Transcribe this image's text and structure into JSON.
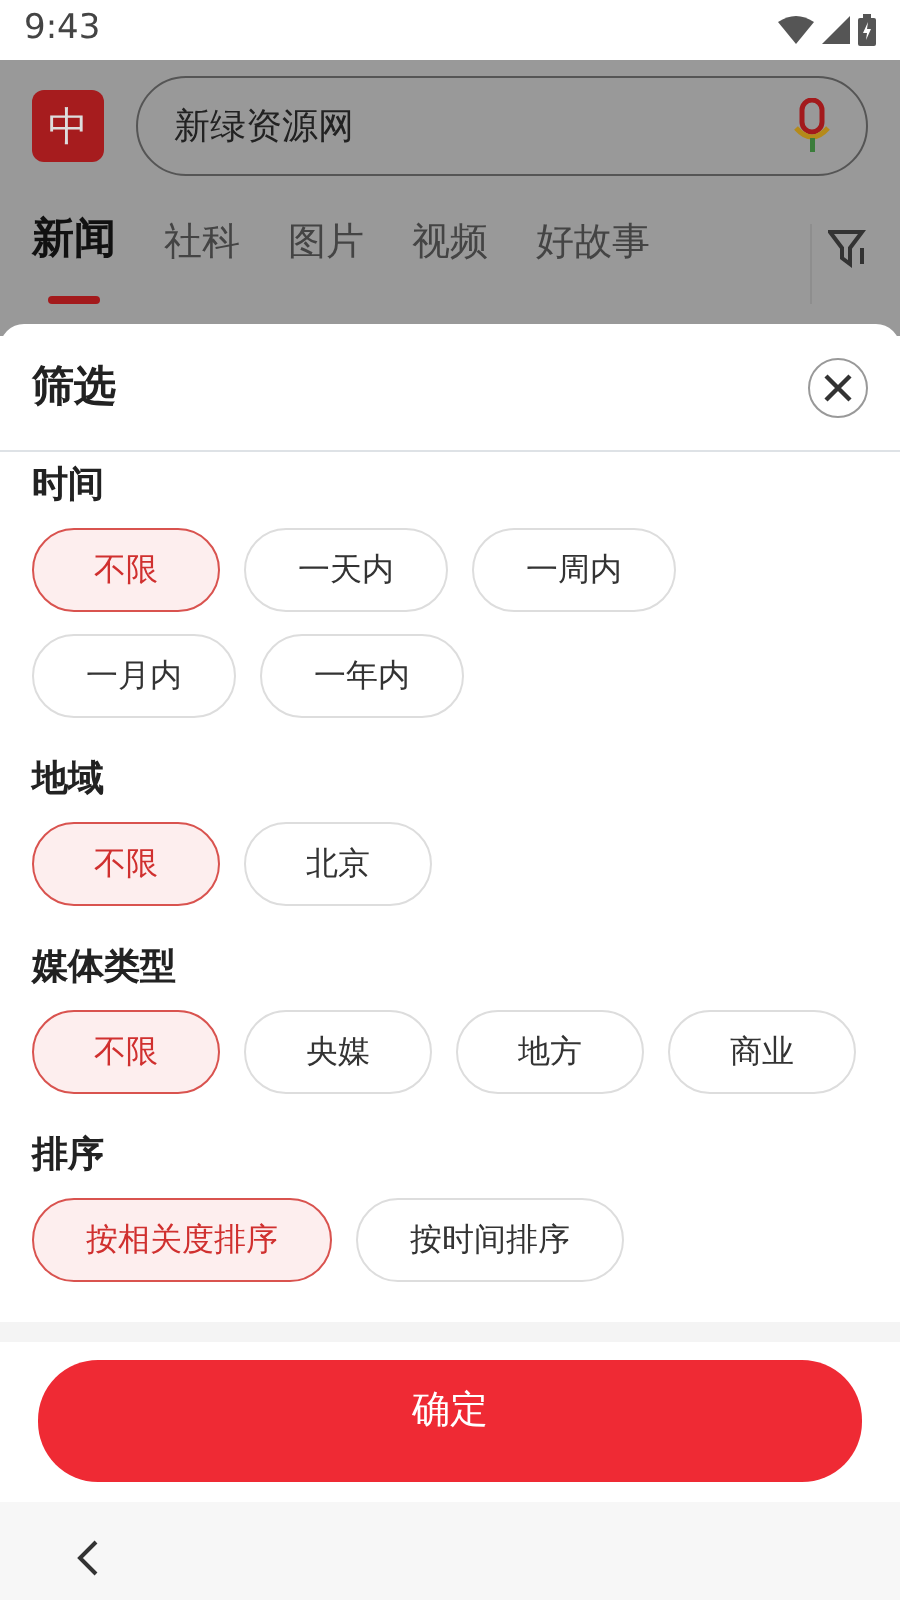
{
  "status_bar": {
    "time": "9:43"
  },
  "header": {
    "logo": "中",
    "search": {
      "value": "新绿资源网"
    },
    "tabs": [
      {
        "label": "新闻",
        "selected": true
      },
      {
        "label": "社科",
        "selected": false
      },
      {
        "label": "图片",
        "selected": false
      },
      {
        "label": "视频",
        "selected": false
      },
      {
        "label": "好故事",
        "selected": false
      }
    ]
  },
  "filter_sheet": {
    "title": "筛选",
    "sections": [
      {
        "title": "时间",
        "options": [
          {
            "label": "不限",
            "selected": true
          },
          {
            "label": "一天内",
            "selected": false
          },
          {
            "label": "一周内",
            "selected": false
          },
          {
            "label": "一月内",
            "selected": false
          },
          {
            "label": "一年内",
            "selected": false
          }
        ]
      },
      {
        "title": "地域",
        "options": [
          {
            "label": "不限",
            "selected": true
          },
          {
            "label": "北京",
            "selected": false
          }
        ]
      },
      {
        "title": "媒体类型",
        "options": [
          {
            "label": "不限",
            "selected": true
          },
          {
            "label": "央媒",
            "selected": false
          },
          {
            "label": "地方",
            "selected": false
          },
          {
            "label": "商业",
            "selected": false
          }
        ]
      },
      {
        "title": "排序",
        "options": [
          {
            "label": "按相关度排序",
            "selected": true
          },
          {
            "label": "按时间排序",
            "selected": false
          }
        ]
      }
    ],
    "confirm_button": "确定"
  }
}
